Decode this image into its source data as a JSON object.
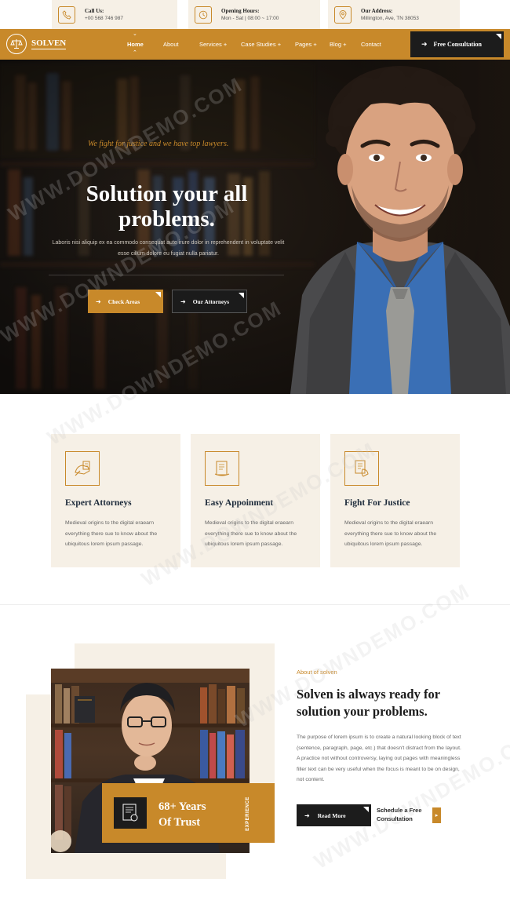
{
  "topbar": {
    "call": {
      "label": "Call Us:",
      "value": "+00 568 746 987",
      "icon": "phone-icon"
    },
    "hours": {
      "label": "Opening Hours:",
      "value": "Mon - Sat | 08:00 ~ 17:00",
      "icon": "clock-icon"
    },
    "address": {
      "label": "Our Address:",
      "value": "Millington, Ave, TN 38053",
      "icon": "location-pin-icon"
    }
  },
  "nav": {
    "logo_text": "SOLVEN",
    "items": [
      {
        "label": "Home"
      },
      {
        "label": "About"
      },
      {
        "label": "Services +"
      },
      {
        "label": "Case Studies +"
      },
      {
        "label": "Pages +"
      },
      {
        "label": "Blog +"
      },
      {
        "label": "Contact"
      }
    ],
    "cta_label": "Free Consultation"
  },
  "hero": {
    "tagline": "We fight for justice and we have top lawyers.",
    "title": "Solution your all problems.",
    "description": "Laboris nisi aliquip ex ea commodo consequat aute irure dolor in reprehendent in voluptate velit esse cillum dolore eu fugiat nulla pariatur.",
    "primary_button": "Check Areas",
    "secondary_button": "Our Attorneys"
  },
  "features": [
    {
      "title": "Expert Attorneys",
      "description": "Medieval origins to the digital eraearn everything there sue to know about the ubiquitous lorem ipsum passage.",
      "icon": "attorney-icon"
    },
    {
      "title": "Easy Appoinment",
      "description": "Medieval origins to the digital eraearn everything there sue to know about the ubiquitous lorem ipsum passage.",
      "icon": "document-icon"
    },
    {
      "title": "Fight For Justice",
      "description": "Medieval origins to the digital eraearn everything there sue to know about the ubiquitous lorem ipsum passage.",
      "icon": "justice-icon"
    }
  ],
  "about": {
    "subtitle": "About of solven",
    "title": "Solven is always ready for solution your problems.",
    "description": "The purpose of lorem ipsum is to create a natural looking block of text (sentence, paragraph, page, etc.) that doesn't distract from the layout. A practice not without controversy, laying out pages with meaningless filler text can be very useful when the focus is meant to be on design, not content.",
    "read_more": "Read More",
    "schedule": "Schedule a Free Consultation",
    "experience": {
      "title": "68+ Years\nOf Trust",
      "vertical": "EXPERIENCE"
    }
  },
  "watermark": "WWW.DOWNDEMO.COM",
  "colors": {
    "accent": "#c8892a",
    "dark": "#1c1c1c",
    "cream": "#f6f0e6",
    "navy": "#1c2a3a"
  }
}
